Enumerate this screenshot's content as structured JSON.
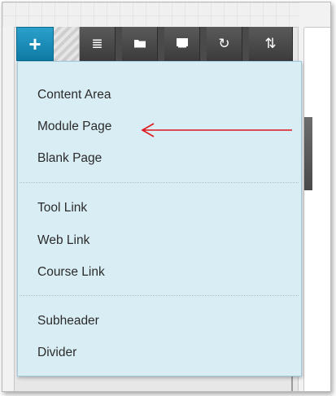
{
  "menu": {
    "group1": [
      "Content Area",
      "Module Page",
      "Blank Page"
    ],
    "group2": [
      "Tool Link",
      "Web Link",
      "Course Link"
    ],
    "group3": [
      "Subheader",
      "Divider"
    ]
  },
  "toolbar": {
    "icons": [
      "plus-icon",
      "list-icon",
      "folder-icon",
      "window-icon",
      "refresh-icon",
      "sort-icon"
    ],
    "plus_glyph": "+",
    "list_glyph": "≣",
    "folder_glyph": "▬",
    "window_glyph": "▭",
    "refresh_glyph": "↻",
    "sort_glyph": "⇅"
  },
  "colors": {
    "accent": "#1a8fbd",
    "menu_bg": "#d9edf4",
    "annotation_arrow": "#e0141c"
  }
}
